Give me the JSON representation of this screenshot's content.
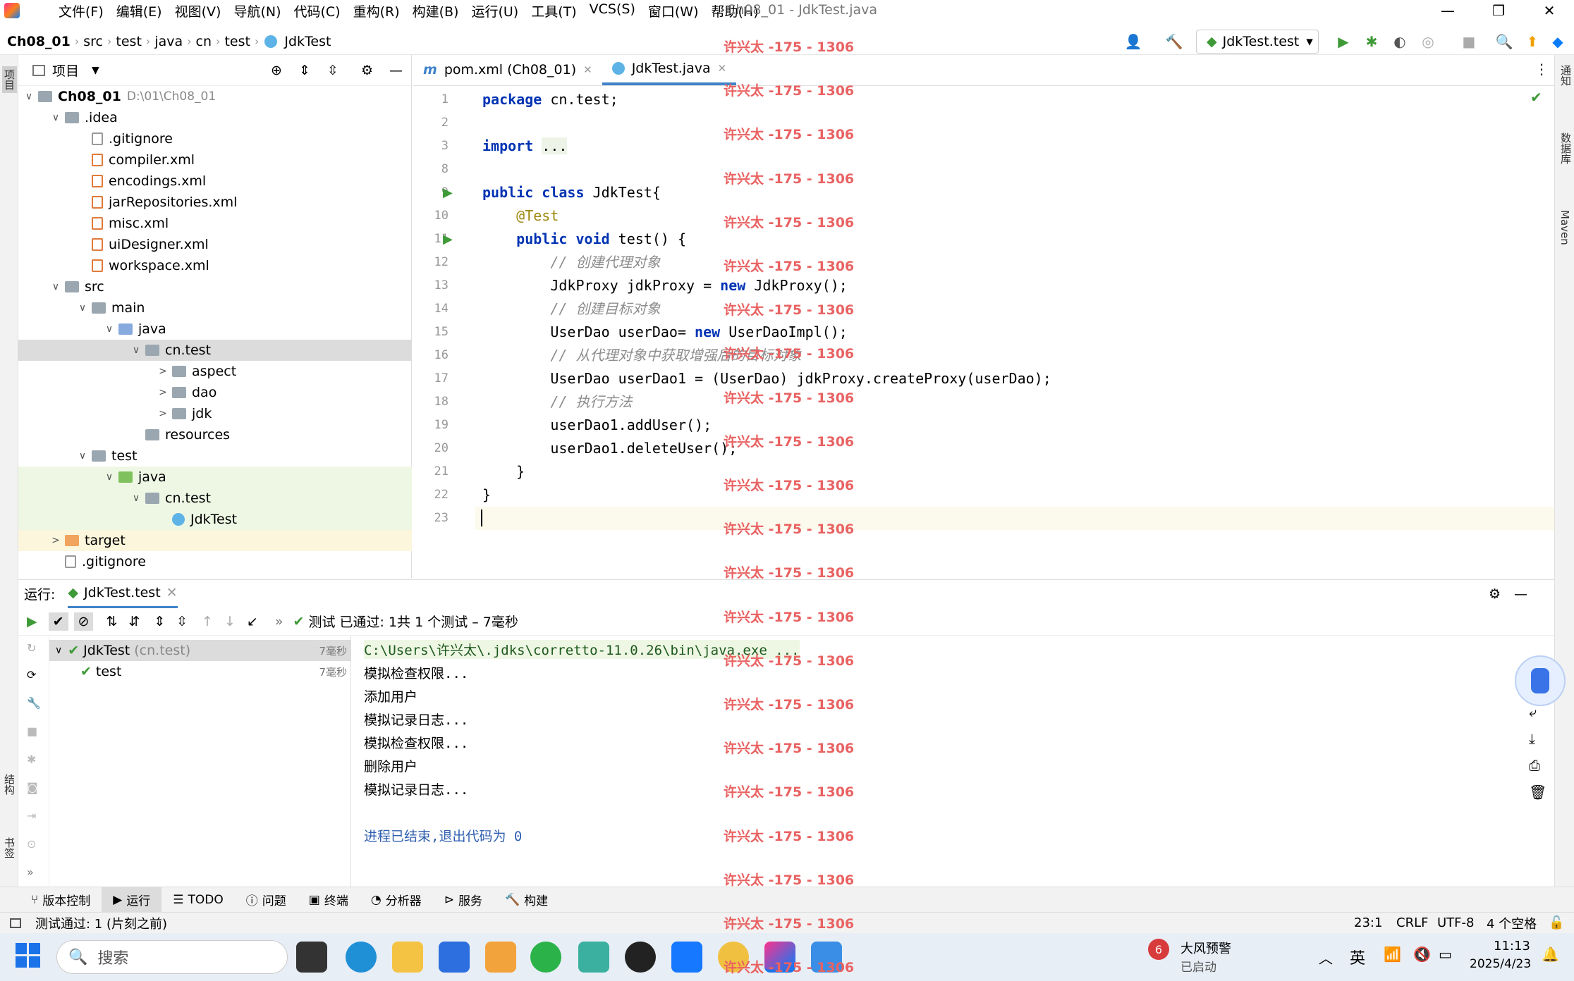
{
  "window": {
    "title": "Ch08_01 - JdkTest.java"
  },
  "menu": [
    "文件(F)",
    "编辑(E)",
    "视图(V)",
    "导航(N)",
    "代码(C)",
    "重构(R)",
    "构建(B)",
    "运行(U)",
    "工具(T)",
    "VCS(S)",
    "窗口(W)",
    "帮助(H)"
  ],
  "breadcrumb": [
    "Ch08_01",
    "src",
    "test",
    "java",
    "cn",
    "test",
    "JdkTest"
  ],
  "run_config": "JdkTest.test",
  "project_panel": {
    "title": "项目"
  },
  "tree": [
    {
      "label": "Ch08_01",
      "sub": "D:\\01\\Ch08_01",
      "arrow": "∨",
      "icon": "fold",
      "indent": 0,
      "bold": true
    },
    {
      "label": ".idea",
      "arrow": "∨",
      "icon": "fold",
      "indent": 1
    },
    {
      "label": ".gitignore",
      "arrow": "",
      "icon": "fgit",
      "indent": 2
    },
    {
      "label": "compiler.xml",
      "arrow": "",
      "icon": "fxml",
      "indent": 2
    },
    {
      "label": "encodings.xml",
      "arrow": "",
      "icon": "fxml",
      "indent": 2
    },
    {
      "label": "jarRepositories.xml",
      "arrow": "",
      "icon": "fxml",
      "indent": 2
    },
    {
      "label": "misc.xml",
      "arrow": "",
      "icon": "fxml",
      "indent": 2
    },
    {
      "label": "uiDesigner.xml",
      "arrow": "",
      "icon": "fxml",
      "indent": 2
    },
    {
      "label": "workspace.xml",
      "arrow": "",
      "icon": "fxml",
      "indent": 2
    },
    {
      "label": "src",
      "arrow": "∨",
      "icon": "fold",
      "indent": 1
    },
    {
      "label": "main",
      "arrow": "∨",
      "icon": "fold",
      "indent": 2
    },
    {
      "label": "java",
      "arrow": "∨",
      "icon": "fold-b",
      "indent": 3
    },
    {
      "label": "cn.test",
      "arrow": "∨",
      "icon": "fold",
      "indent": 4,
      "sel": true
    },
    {
      "label": "aspect",
      "arrow": ">",
      "icon": "fold",
      "indent": 5
    },
    {
      "label": "dao",
      "arrow": ">",
      "icon": "fold",
      "indent": 5
    },
    {
      "label": "jdk",
      "arrow": ">",
      "icon": "fold",
      "indent": 5
    },
    {
      "label": "resources",
      "arrow": "",
      "icon": "fold",
      "indent": 4
    },
    {
      "label": "test",
      "arrow": "∨",
      "icon": "fold",
      "indent": 2
    },
    {
      "label": "java",
      "arrow": "∨",
      "icon": "fold-g",
      "indent": 3,
      "test": true
    },
    {
      "label": "cn.test",
      "arrow": "∨",
      "icon": "fold",
      "indent": 4,
      "test": true
    },
    {
      "label": "JdkTest",
      "arrow": "",
      "icon": "fcls",
      "indent": 5,
      "test": true
    },
    {
      "label": "target",
      "arrow": ">",
      "icon": "fold-o",
      "indent": 1,
      "excl": true
    },
    {
      "label": ".gitignore",
      "arrow": "",
      "icon": "fgit",
      "indent": 1
    }
  ],
  "editor_tabs": [
    {
      "label": "pom.xml (Ch08_01)",
      "active": false
    },
    {
      "label": "JdkTest.java",
      "active": true
    }
  ],
  "code_lines": [
    {
      "n": "1",
      "html": "<span class='kw'>package</span> cn.test;"
    },
    {
      "n": "2",
      "html": ""
    },
    {
      "n": "3",
      "html": "<span class='kw'>import</span> <span style='background:#eef3e8'>...</span>"
    },
    {
      "n": "8",
      "html": ""
    },
    {
      "n": "9",
      "html": "<span class='kw'>public class</span> JdkTest{"
    },
    {
      "n": "10",
      "html": "    <span class='ann'>@Test</span>"
    },
    {
      "n": "11",
      "html": "    <span class='kw'>public void</span> test() {"
    },
    {
      "n": "12",
      "html": "        <span class='cm'>// 创建代理对象</span>"
    },
    {
      "n": "13",
      "html": "        JdkProxy jdkProxy = <span class='kw'>new</span> JdkProxy();"
    },
    {
      "n": "14",
      "html": "        <span class='cm'>// 创建目标对象</span>"
    },
    {
      "n": "15",
      "html": "        UserDao userDao= <span class='kw'>new</span> UserDaoImpl();"
    },
    {
      "n": "16",
      "html": "        <span class='cm'>// 从代理对象中获取增强后的目标对象</span>"
    },
    {
      "n": "17",
      "html": "        UserDao userDao1 = (UserDao) jdkProxy.createProxy(userDao);"
    },
    {
      "n": "18",
      "html": "        <span class='cm'>// 执行方法</span>"
    },
    {
      "n": "19",
      "html": "        userDao1.addUser();"
    },
    {
      "n": "20",
      "html": "        userDao1.deleteUser();"
    },
    {
      "n": "21",
      "html": "    }"
    },
    {
      "n": "22",
      "html": "}"
    },
    {
      "n": "23",
      "html": ""
    }
  ],
  "watermark": "许兴太 -175 - 1306",
  "run_panel": {
    "label": "运行:",
    "tab": "JdkTest.test",
    "status": "测试 已通过: 1共 1 个测试 – 7毫秒"
  },
  "run_tree": [
    {
      "label": "JdkTest",
      "sub": "(cn.test)",
      "time": "7毫秒"
    },
    {
      "label": "test",
      "sub": "",
      "time": "7毫秒"
    }
  ],
  "console": [
    "C:\\Users\\许兴太\\.jdks\\corretto-11.0.26\\bin\\java.exe ...",
    "模拟检查权限...",
    "添加用户",
    "模拟记录日志...",
    "模拟检查权限...",
    "删除用户",
    "模拟记录日志...",
    "",
    "进程已结束,退出代码为 0"
  ],
  "bottom_tabs": [
    "版本控制",
    "运行",
    "TODO",
    "问题",
    "终端",
    "分析器",
    "服务",
    "构建"
  ],
  "status": {
    "left": "测试通过: 1 (片刻之前)",
    "pos": "23:1",
    "eol": "CRLF",
    "enc": "UTF-8",
    "indent": "4 个空格"
  },
  "right_tools": [
    "通知",
    "数据库",
    "Maven"
  ],
  "left_tools": [
    "项目",
    "结构",
    "书签"
  ],
  "taskbar": {
    "search": "搜索",
    "weather": "大风预警",
    "weather_sub": "已启动",
    "weather_badge": "6",
    "ime": "英",
    "time": "11:13",
    "date": "2025/4/23"
  },
  "colors": {
    "accent": "#4083c9",
    "pass": "#3e9a37",
    "watermark": "#e96262"
  }
}
